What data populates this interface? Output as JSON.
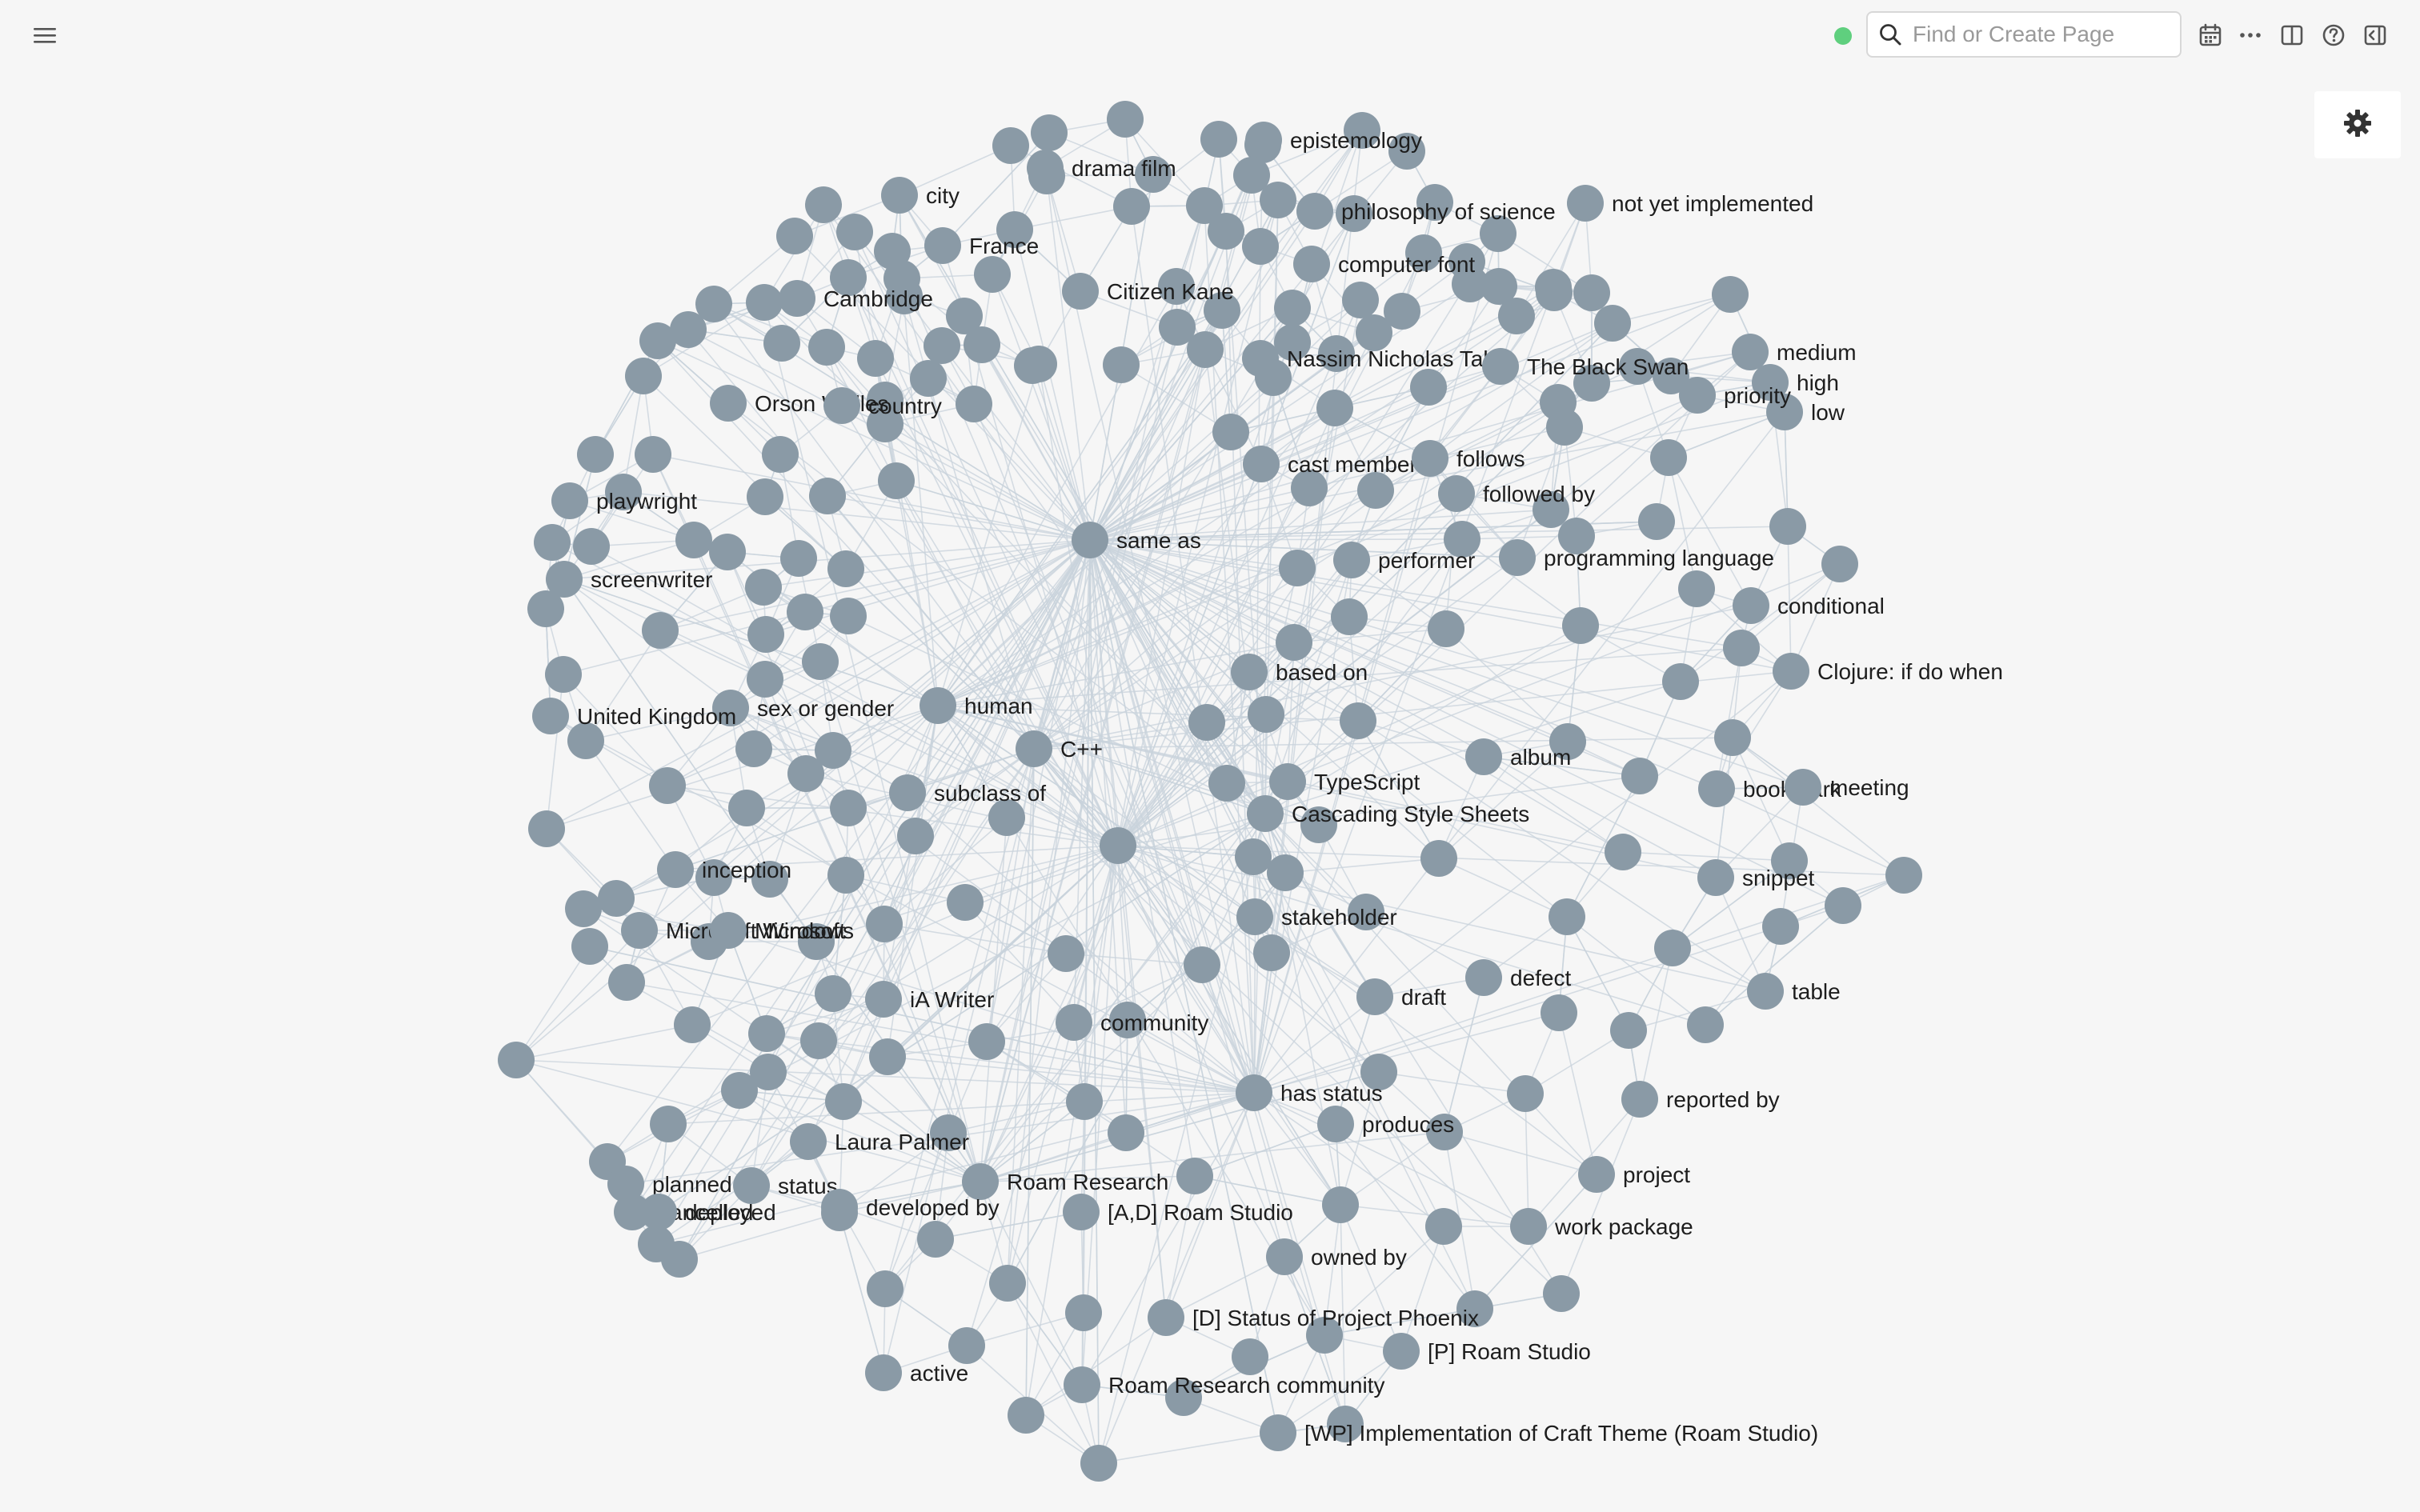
{
  "app": {
    "sync_status_color": "#5fcf7e"
  },
  "topbar": {
    "menu_icon": "hamburger-icon",
    "search": {
      "placeholder": "Find or Create Page",
      "value": ""
    },
    "icons": [
      "calendar-icon",
      "more-icon",
      "split-panel-icon",
      "help-icon",
      "right-sidebar-icon"
    ]
  },
  "graph": {
    "settings_icon": "gear-icon",
    "node_color": "#8a9aa6",
    "edge_color": "#c9d3dc",
    "labels": {
      "epistemology": "epistemology",
      "drama_film": "drama film",
      "city": "city",
      "philosophy_of_science": "philosophy of science",
      "not_yet_implemented": "not yet implemented",
      "france": "France",
      "computer_font": "computer font",
      "citizen_kane": "Citizen Kane",
      "cambridge": "Cambridge",
      "medium": "medium",
      "high": "high",
      "low": "low",
      "priority": "priority",
      "nassim_taleb": "Nassim Nicholas Taleb",
      "black_swan": "The Black Swan",
      "orson_welles": "Orson Welles",
      "country": "country",
      "cast_member": "cast member",
      "follows": "follows",
      "followed_by": "followed by",
      "playwright": "playwright",
      "same_as": "same as",
      "performer": "performer",
      "programming_language": "programming language",
      "screenwriter": "screenwriter",
      "conditional": "conditional",
      "based_on": "based on",
      "clojure": "Clojure: if do when",
      "human": "human",
      "sex_or_gender": "sex or gender",
      "united_kingdom": "United Kingdom",
      "cpp": "C++",
      "album": "album",
      "typescript": "TypeScript",
      "bookmark": "bookmark",
      "meeting": "meeting",
      "subclass_of": "subclass of",
      "css": "Cascading Style Sheets",
      "inception": "inception",
      "snippet": "snippet",
      "microsoft_windows": "Microsoft Windows",
      "microsoft": "Microsoft",
      "stakeholder": "stakeholder",
      "defect": "defect",
      "ia_writer": "iA Writer",
      "draft": "draft",
      "table": "table",
      "community": "community",
      "has_status": "has status",
      "reported_by": "reported by",
      "produces": "produces",
      "laura_palmer": "Laura Palmer",
      "planned": "planned",
      "status": "status",
      "roam_research": "Roam Research",
      "project": "project",
      "cancelled": "cancelled",
      "deployed": "deployed",
      "developed_by": "developed by",
      "ad_roam_studio": "[A,D] Roam Studio",
      "work_package": "work package",
      "owned_by": "owned by",
      "d_status_phoenix": "[D] Status of Project Phoenix",
      "p_roam_studio": "[P] Roam Studio",
      "active": "active",
      "roam_research_community": "Roam Research community",
      "wp_craft_theme": "[WP] Implementation of Craft Theme (Roam Studio)"
    }
  }
}
